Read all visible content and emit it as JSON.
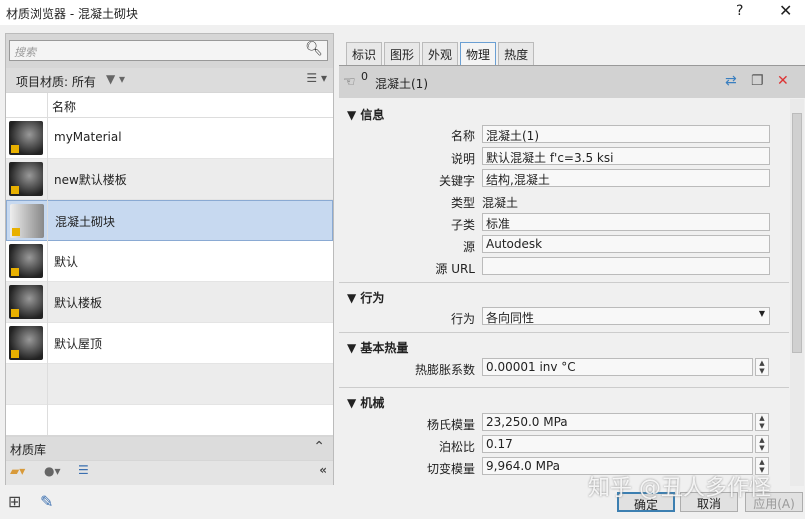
{
  "window": {
    "title": "材质浏览器 - 混凝土砌块",
    "help": "?",
    "close": "✕"
  },
  "browser": {
    "search_placeholder": "搜索",
    "filter_label": "项目材质: 所有",
    "column_name": "名称",
    "materials": [
      {
        "name": "myMaterial"
      },
      {
        "name": "new默认楼板"
      },
      {
        "name": "混凝土砌块",
        "selected": true
      },
      {
        "name": "默认"
      },
      {
        "name": "默认楼板"
      },
      {
        "name": "默认屋顶"
      }
    ],
    "library_label": "材质库"
  },
  "tabs": [
    "标识",
    "图形",
    "外观",
    "物理",
    "热度"
  ],
  "active_tab": "物理",
  "asset": {
    "count": "0",
    "name": "混凝土(1)"
  },
  "sections": {
    "info": {
      "title": "信息",
      "name_label": "名称",
      "name": "混凝土(1)",
      "desc_label": "说明",
      "desc": "默认混凝土 f'c=3.5 ksi",
      "kw_label": "关键字",
      "kw": "结构,混凝土",
      "type_label": "类型",
      "type": "混凝土",
      "subtype_label": "子类",
      "subtype": "标准",
      "source_label": "源",
      "source": "Autodesk",
      "url_label": "源 URL",
      "url": ""
    },
    "behavior": {
      "title": "行为",
      "label": "行为",
      "value": "各向同性"
    },
    "thermal": {
      "title": "基本热量",
      "exp_label": "热膨胀系数",
      "exp": "0.00001 inv °C"
    },
    "mech": {
      "title": "机械",
      "young_label": "杨氏模量",
      "young": "23,250.0 MPa",
      "poisson_label": "泊松比",
      "poisson": "0.17",
      "shear_label": "切变模量",
      "shear": "9,964.0 MPa"
    }
  },
  "buttons": {
    "ok": "确定",
    "cancel": "取消",
    "apply": "应用(A)"
  },
  "watermark": "知乎 @丑人多作怪"
}
